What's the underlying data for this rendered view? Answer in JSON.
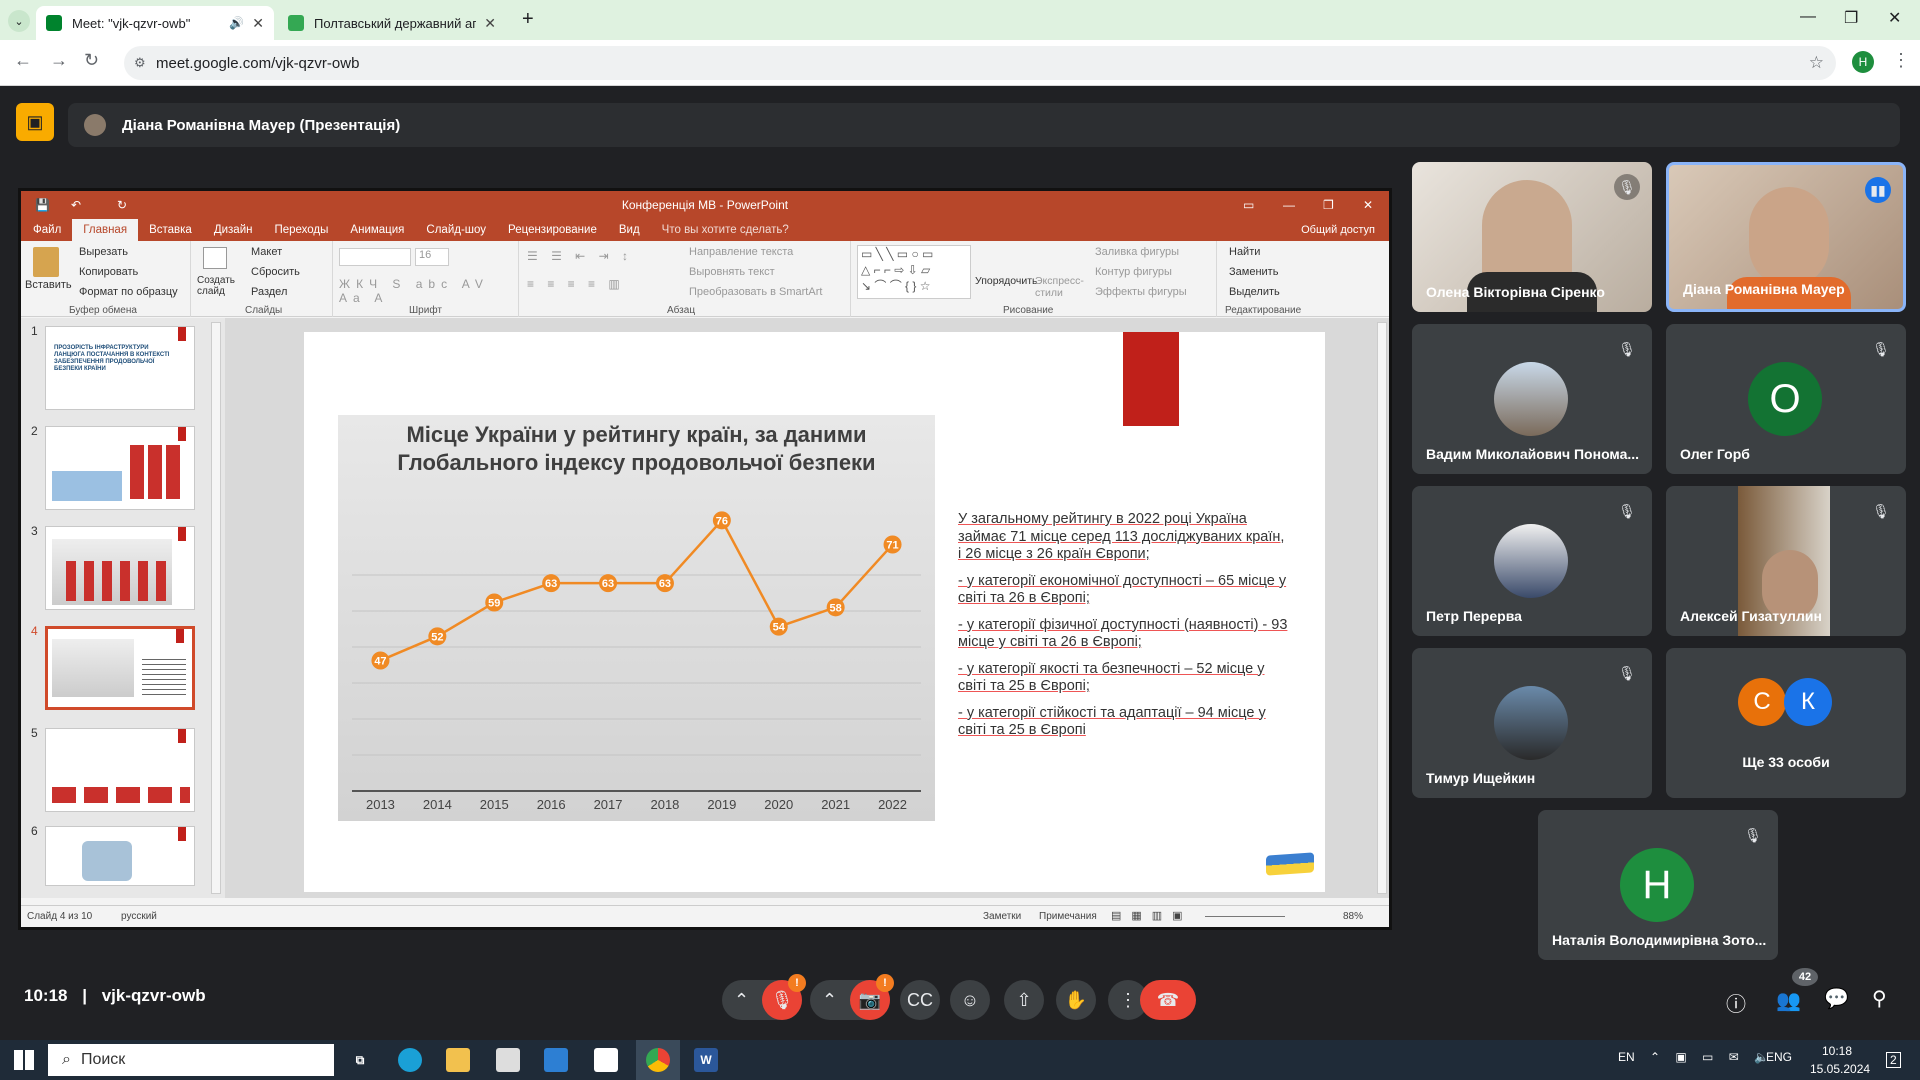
{
  "browser": {
    "tabs": [
      {
        "title": "Meet: \"vjk-qzvr-owb\"",
        "favicon_color": "#00832d"
      },
      {
        "title": "Полтавський державний агра",
        "favicon_color": "#34a853"
      }
    ],
    "url": "meet.google.com/vjk-qzvr-owb",
    "profile_initial": "Н"
  },
  "meet": {
    "presenter_banner": "Діана Романівна Мауер (Презентація)",
    "meeting_code": "vjk-qzvr-owb",
    "time": "10:18",
    "separator": "|",
    "participants_count": "42",
    "tiles": [
      {
        "name": "Олена Вікторівна Сіренко",
        "type": "video"
      },
      {
        "name": "Діана Романівна Мауер",
        "type": "video"
      },
      {
        "name": "Вадим Миколайович Понома...",
        "type": "photo"
      },
      {
        "name": "Олег Горб",
        "type": "avatar",
        "initial": "О",
        "color": "#137333"
      },
      {
        "name": "Петр Перерва",
        "type": "photo"
      },
      {
        "name": "Алексей Гизатуллин",
        "type": "video"
      },
      {
        "name": "Тимур Ищейкин",
        "type": "photo"
      },
      {
        "name": "Ще 33 особи",
        "type": "group",
        "initials": [
          "С",
          "К"
        ],
        "colors": [
          "#e8710a",
          "#1a73e8"
        ]
      },
      {
        "name": "Наталія Володимирівна Зото...",
        "type": "avatar",
        "initial": "Н",
        "color": "#1e8e3e"
      }
    ],
    "controls": {
      "mic_badge": "!",
      "cam_badge": "!"
    }
  },
  "powerpoint": {
    "window_title": "Конференція МВ - PowerPoint",
    "menu": [
      "Файл",
      "Главная",
      "Вставка",
      "Дизайн",
      "Переходы",
      "Анимация",
      "Слайд-шоу",
      "Рецензирование",
      "Вид",
      "Что вы хотите сделать?"
    ],
    "share_label": "Общий доступ",
    "clipboard": {
      "paste": "Вставить",
      "cut": "Вырезать",
      "copy": "Копировать",
      "format": "Формат по образцу",
      "group": "Буфер обмена"
    },
    "slides_group": {
      "create": "Создать слайд",
      "layout": "Макет",
      "reset": "Сбросить",
      "section": "Раздел",
      "group": "Слайды"
    },
    "font_group": {
      "size": "16",
      "group": "Шрифт"
    },
    "paragraph_group": {
      "direction": "Направление текста",
      "align": "Выровнять текст",
      "smartart": "Преобразовать в SmartArt",
      "group": "Абзац"
    },
    "drawing_group": {
      "arrange": "Упорядочить",
      "styles": "Экспресс-стили",
      "fill": "Заливка фигуры",
      "outline": "Контур фигуры",
      "effects": "Эффекты фигуры",
      "group": "Рисование"
    },
    "editing_group": {
      "find": "Найти",
      "replace": "Заменить",
      "select": "Выделить",
      "group": "Редактирование"
    },
    "thumbnail_numbers": [
      "1",
      "2",
      "3",
      "4",
      "5",
      "6"
    ],
    "thumb1_text": "ПРОЗОРІСТЬ ІНФРАСТРУКТУРИ ЛАНЦЮГА ПОСТАЧАННЯ В КОНТЕКСТІ ЗАБЕЗПЕЧЕННЯ ПРОДОВОЛЬЧОЇ БЕЗПЕКИ КРАЇНИ",
    "status": {
      "slide": "Слайд 4 из 10",
      "language": "русский",
      "notes": "Заметки",
      "comments": "Примечания",
      "zoom": "88%"
    }
  },
  "slide": {
    "paragraphs": [
      "У загальному рейтингу в 2022 році Україна займає 71 місце серед 113 досліджуваних країн, і 26 місце з 26 країн Європи;",
      "- у категорії економічної доступності – 65 місце у світі та 26 в Європі;",
      "- у категорії фізичної доступності (наявності) - 93 місце у світі та 26 в Європі;",
      "- у категорії якості та безпечності – 52 місце у світі та 25 в Європі;",
      "- у категорії стійкості та адаптації – 94 місце у світі та 25 в Європі"
    ]
  },
  "chart_data": {
    "type": "line",
    "title": "Місце України у рейтингу країн, за даними Глобального індексу продовольчої безпеки",
    "x": [
      "2013",
      "2014",
      "2015",
      "2016",
      "2017",
      "2018",
      "2019",
      "2020",
      "2021",
      "2022"
    ],
    "values": [
      47,
      52,
      59,
      63,
      63,
      63,
      76,
      54,
      58,
      71
    ],
    "color": "#f08a24",
    "grid": true
  },
  "taskbar": {
    "search_placeholder": "Поиск",
    "lang": "EN",
    "lang2": "ENG",
    "time": "10:18",
    "date": "15.05.2024",
    "notifications": "2"
  }
}
